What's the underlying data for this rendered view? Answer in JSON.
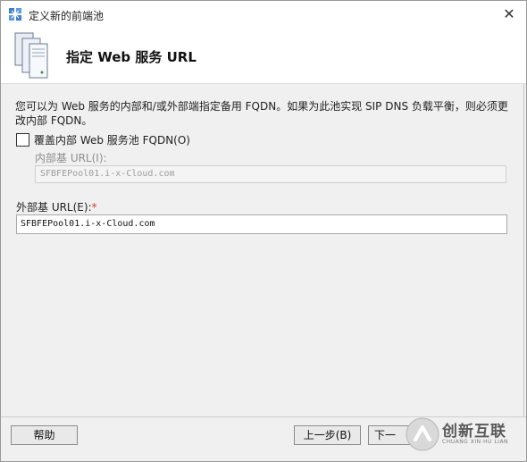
{
  "window": {
    "title": "定义新的前端池",
    "close_glyph": "✕"
  },
  "header": {
    "title": "指定 Web 服务 URL",
    "icon": "server-stack-icon"
  },
  "content": {
    "description": "您可以为 Web 服务的内部和/或外部端指定备用 FQDN。如果为此池实现 SIP DNS 负载平衡，则必须更改内部 FQDN。",
    "override_checkbox": {
      "label": "覆盖内部 Web 服务池 FQDN(O)",
      "checked": false
    },
    "internal_url": {
      "label": "内部基 URL(I):",
      "value": "SFBFEPool01.i-x-Cloud.com",
      "enabled": false
    },
    "external_url": {
      "label": "外部基 URL(E):",
      "required_marker": "*",
      "value": "SFBFEPool01.i-x-Cloud.com"
    }
  },
  "footer": {
    "help_label": "帮助",
    "back_label": "上一步(B)",
    "next_label": "下一"
  },
  "watermark": {
    "text": "创新互联",
    "subtext": "CHUANG XIN HU LIAN"
  },
  "colors": {
    "required": "#d23b2b",
    "disabled_text": "#9c9c9c",
    "dialog_bg": "#f0f0f0"
  }
}
